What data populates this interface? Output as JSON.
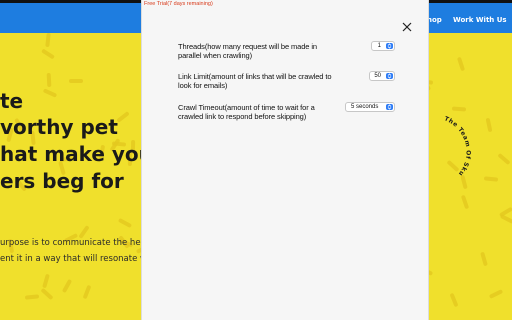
{
  "popup": {
    "trial_text": "Free Trial(7 days remaining)",
    "settings": [
      {
        "label": "Threads(how many request will be made in parallel when crawling)",
        "value": "1",
        "type": "stepper"
      },
      {
        "label": "Link Limit(amount of links that will be crawled to look for emails)",
        "value": "50",
        "type": "stepper"
      },
      {
        "label": "Crawl Timeout(amount of time to wait for a crawled link to respond before skipping)",
        "value": "5 seconds",
        "type": "select"
      }
    ]
  },
  "website": {
    "nav": [
      "hop",
      "Work With Us"
    ],
    "hero_lines": [
      "te",
      "vorthy pet",
      "hat make you",
      "ers beg for"
    ],
    "paragraph_lines": [
      "urpose is to communicate the hea",
      "ent it in a way that will resonate w"
    ],
    "badge_text": "The Team Of Sku"
  },
  "colors": {
    "nav_bg": "#1e7de0",
    "hero_bg": "#f0e02c",
    "accent_blue": "#2e7cf6",
    "trial_red": "#d83a1a"
  },
  "icons": [
    "close-icon",
    "stepper-arrows-icon",
    "select-arrows-icon"
  ]
}
